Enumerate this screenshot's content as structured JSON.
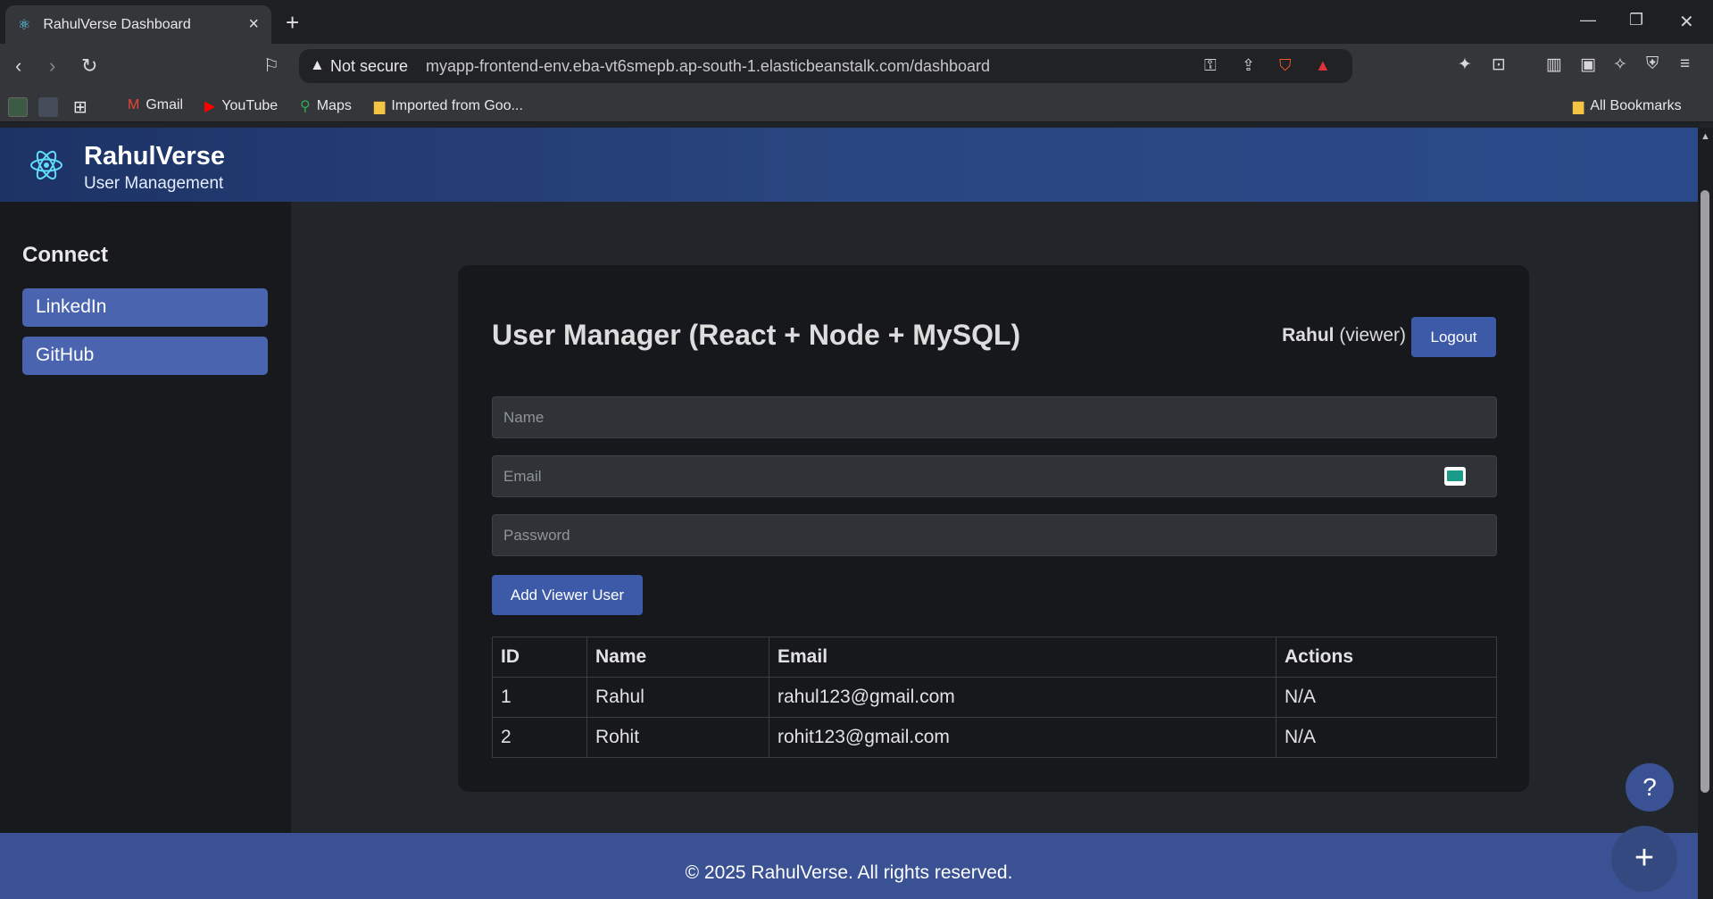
{
  "browser": {
    "tab_title": "RahulVerse Dashboard",
    "not_secure": "Not secure",
    "url": "myapp-frontend-env.eba-vt6smepb.ap-south-1.elasticbeanstalk.com/dashboard",
    "bookmarks": [
      "Gmail",
      "YouTube",
      "Maps",
      "Imported from Goo..."
    ],
    "all_bookmarks": "All Bookmarks"
  },
  "header": {
    "brand": "RahulVerse",
    "subtitle": "User Management"
  },
  "sidebar": {
    "heading": "Connect",
    "links": [
      "LinkedIn",
      "GitHub"
    ]
  },
  "main": {
    "title": "User Manager (React + Node + MySQL)",
    "user_name": "Rahul",
    "user_role": "(viewer)",
    "logout_label": "Logout",
    "name_placeholder": "Name",
    "email_placeholder": "Email",
    "password_placeholder": "Password",
    "add_button_label": "Add Viewer User",
    "table": {
      "headers": [
        "ID",
        "Name",
        "Email",
        "Actions"
      ],
      "rows": [
        [
          "1",
          "Rahul",
          "rahul123@gmail.com",
          "N/A"
        ],
        [
          "2",
          "Rohit",
          "rohit123@gmail.com",
          "N/A"
        ]
      ]
    }
  },
  "footer": {
    "text": "© 2025 RahulVerse. All rights reserved."
  },
  "fabs": {
    "help": "?",
    "add": "+"
  }
}
